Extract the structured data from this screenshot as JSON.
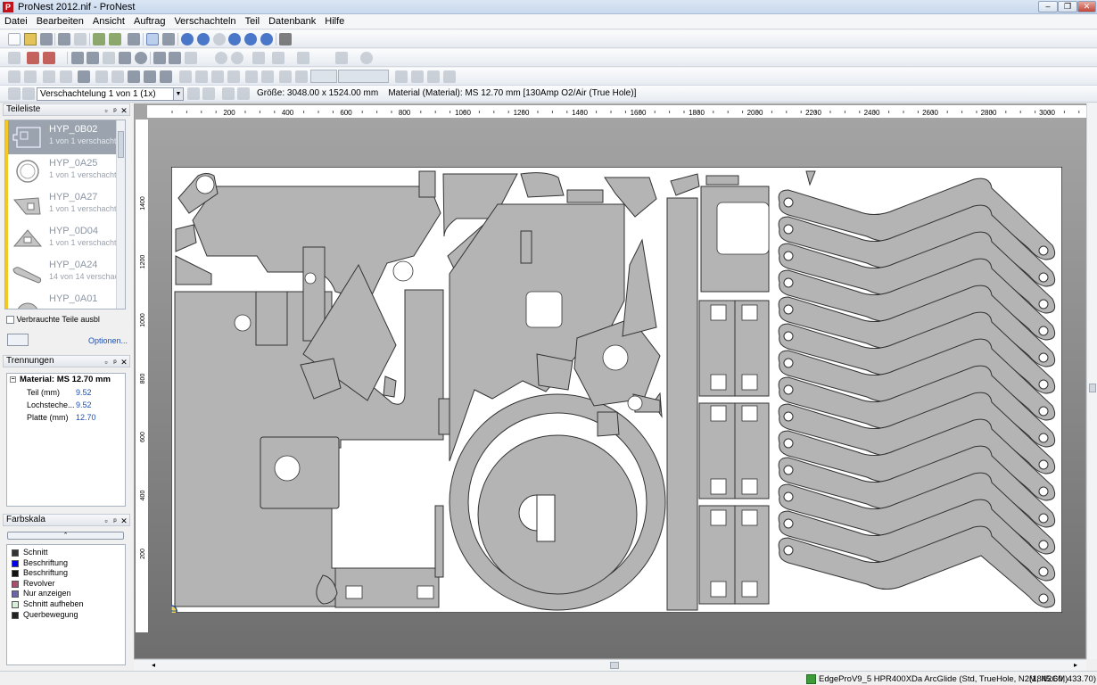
{
  "window": {
    "title": "ProNest 2012.nif - ProNest"
  },
  "menu": [
    "Datei",
    "Bearbeiten",
    "Ansicht",
    "Auftrag",
    "Verschachteln",
    "Teil",
    "Datenbank",
    "Hilfe"
  ],
  "nestbar": {
    "combo": "Verschachtelung 1 von 1 (1x)",
    "size": "Größe: 3048.00 x 1524.00 mm",
    "material": "Material (Material): MS 12.70 mm [130Amp O2/Air (True Hole)]"
  },
  "partlist": {
    "title": "Teileliste",
    "parts": [
      {
        "name": "HYP_0B02",
        "count": "1 von 1 verschachtelt"
      },
      {
        "name": "HYP_0A25",
        "count": "1 von 1 verschachtelt"
      },
      {
        "name": "HYP_0A27",
        "count": "1 von 1 verschachtelt"
      },
      {
        "name": "HYP_0D04",
        "count": "1 von 1 verschachtelt"
      },
      {
        "name": "HYP_0A24",
        "count": "14 von 14 verschachtelt"
      },
      {
        "name": "HYP_0A01",
        "count": ""
      }
    ],
    "used_parts_label": "Verbrauchte Teile ausbl",
    "options_link": "Optionen..."
  },
  "separations": {
    "title": "Trennungen",
    "material_label": "Material: MS 12.70 mm",
    "rows": [
      {
        "label": "Teil (mm)",
        "value": "9.52"
      },
      {
        "label": "Lochsteche...",
        "value": "9.52"
      },
      {
        "label": "Platte (mm)",
        "value": "12.70"
      }
    ]
  },
  "colorscale": {
    "title": "Farbskala",
    "items": [
      {
        "label": "Schnitt",
        "color": "#333333"
      },
      {
        "label": "Beschriftung",
        "color": "#0000ee"
      },
      {
        "label": "Beschriftung",
        "color": "#111111"
      },
      {
        "label": "Revolver",
        "color": "#a8506e"
      },
      {
        "label": "Nur anzeigen",
        "color": "#6c64a8"
      },
      {
        "label": "Schnitt aufheben",
        "color": "#d8f0d8"
      },
      {
        "label": "Querbewegung",
        "color": "#222222"
      }
    ]
  },
  "ruler": {
    "h_ticks": [
      "200",
      "400",
      "600",
      "800",
      "1000",
      "1200",
      "1400",
      "1600",
      "1800",
      "2000",
      "2200",
      "2400",
      "2600",
      "2800",
      "3000"
    ],
    "v_ticks": [
      "1400",
      "1200",
      "1000",
      "800",
      "600",
      "400",
      "200"
    ]
  },
  "status": {
    "machine": "EdgeProV9_5 HPR400XDa ArcGlide (Std, TrueHole, N2M, N2CM)",
    "coords": "(1845.60, 433.70)"
  }
}
